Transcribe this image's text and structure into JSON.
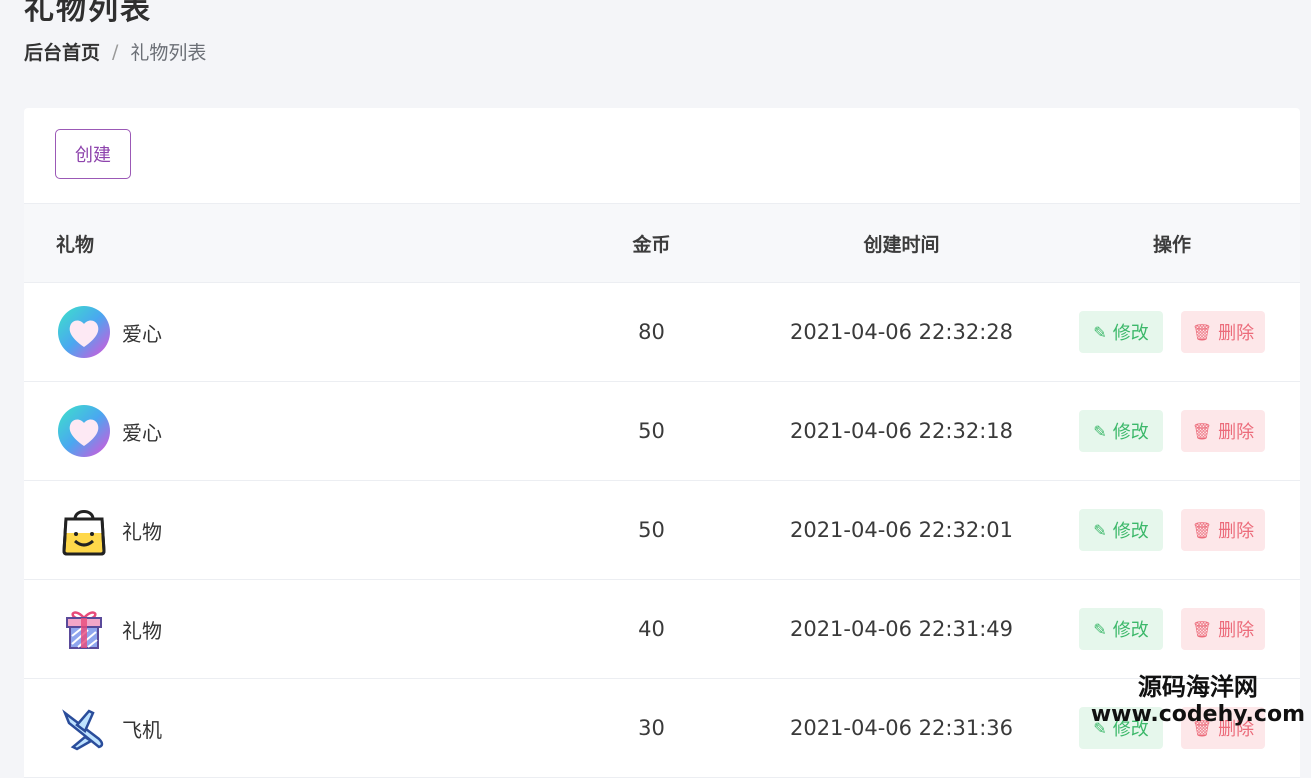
{
  "page": {
    "title": "礼物列表",
    "breadcrumb": {
      "home": "后台首页",
      "separator": "/",
      "current": "礼物列表"
    }
  },
  "toolbar": {
    "create_label": "创建"
  },
  "table": {
    "headers": {
      "gift": "礼物",
      "coins": "金币",
      "created_at": "创建时间",
      "actions": "操作"
    },
    "rows": [
      {
        "icon": "heart-icon",
        "name": "爱心",
        "coins": "80",
        "created_at": "2021-04-06 22:32:28",
        "edit": "修改",
        "delete": "删除"
      },
      {
        "icon": "heart-icon",
        "name": "爱心",
        "coins": "50",
        "created_at": "2021-04-06 22:32:18",
        "edit": "修改",
        "delete": "删除"
      },
      {
        "icon": "bag-icon",
        "name": "礼物",
        "coins": "50",
        "created_at": "2021-04-06 22:32:01",
        "edit": "修改",
        "delete": "删除"
      },
      {
        "icon": "giftbox-icon",
        "name": "礼物",
        "coins": "40",
        "created_at": "2021-04-06 22:31:49",
        "edit": "修改",
        "delete": "删除"
      },
      {
        "icon": "airplane-icon",
        "name": "飞机",
        "coins": "30",
        "created_at": "2021-04-06 22:31:36",
        "edit": "修改",
        "delete": "删除"
      }
    ]
  },
  "watermark": {
    "text": "源码海洋网",
    "url": "www.codehy.com"
  },
  "colors": {
    "accent": "#8e44ad",
    "edit": "#3cb86a",
    "delete": "#ec6b7a"
  }
}
